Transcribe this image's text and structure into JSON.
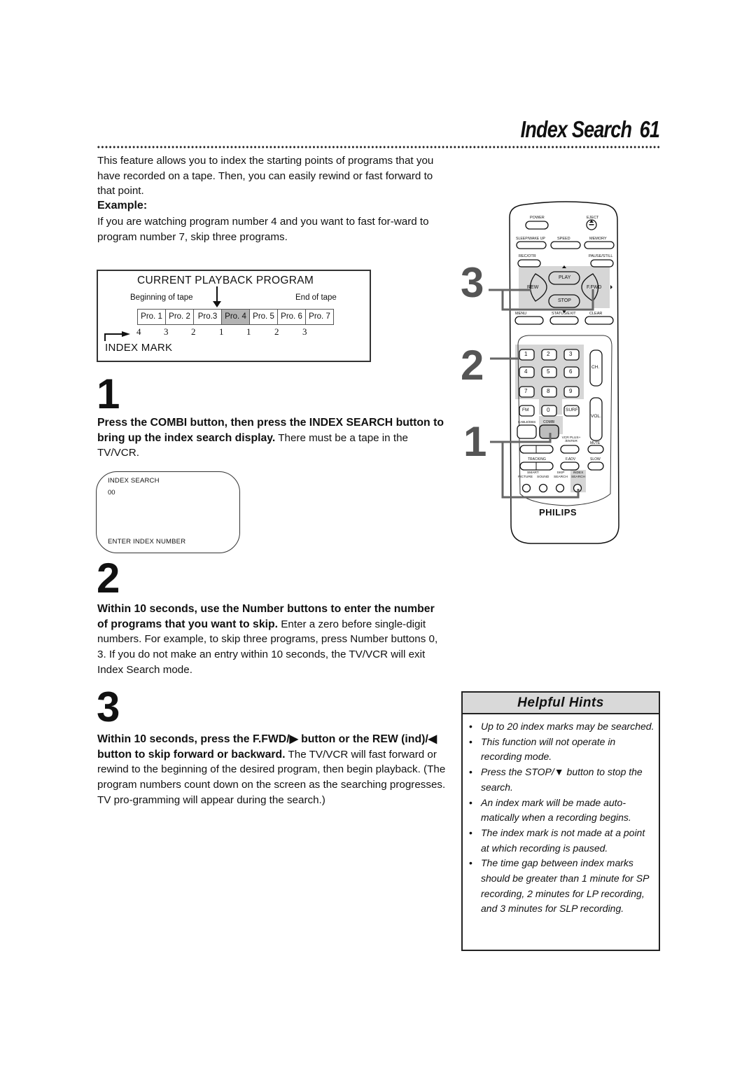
{
  "header": {
    "title": "Index Search",
    "page_number": "61"
  },
  "intro": "This feature allows you to index the starting points of programs that you have recorded on a tape. Then, you can easily rewind or fast forward to that point.",
  "example": {
    "heading": "Example:",
    "text": "If you are watching program number 4 and you want to fast for-ward to program number 7, skip three programs."
  },
  "diagram": {
    "title": "CURRENT PLAYBACK PROGRAM",
    "beginning_label": "Beginning of tape",
    "end_label": "End of tape",
    "programs": [
      "Pro. 1",
      "Pro. 2",
      "Pro.3",
      "Pro. 4",
      "Pro. 5",
      "Pro. 6",
      "Pro. 7"
    ],
    "current_program_index": 3,
    "index_marks": [
      "4",
      "3",
      "2",
      "1",
      "1",
      "2",
      "3"
    ],
    "index_mark_label": "INDEX MARK"
  },
  "steps": [
    {
      "number": "1",
      "bold": "Press the COMBI button, then press the INDEX SEARCH button to bring up the index search display.",
      "text": " There must be a tape in the TV/VCR."
    },
    {
      "number": "2",
      "bold": "Within 10 seconds, use the Number buttons to enter the number of programs that you want to skip.",
      "text": " Enter a zero before single-digit numbers. For example, to skip three programs, press Number buttons 0, 3. If you do not make an entry within 10 seconds, the TV/VCR will exit Index Search mode."
    },
    {
      "number": "3",
      "bold": "Within 10 seconds, press the F.FWD/▶ button or the REW (ind)/◀ button to skip forward or backward.",
      "text": " The TV/VCR will fast forward or rewind to the beginning of the desired program, then begin playback. (The program numbers count down on the screen as the searching progresses. TV pro-gramming will appear during the search.)"
    }
  ],
  "osd_screen": {
    "line1": "INDEX SEARCH",
    "line2": "00",
    "line3": "ENTER INDEX NUMBER"
  },
  "remote": {
    "callouts": [
      "3",
      "2",
      "1"
    ],
    "brand": "PHILIPS",
    "buttons": {
      "power": "POWER",
      "eject": "EJECT",
      "sleep": "SLEEP/WAKE UP",
      "speed": "SPEED",
      "memory": "MEMORY",
      "rec": "REC/OTR",
      "pause": "PAUSE/STILL",
      "play": "PLAY",
      "rew": "REW",
      "ffwd": "F.FWD",
      "stop": "STOP",
      "menu": "MENU",
      "status": "STATUS/EXIT",
      "clear": "CLEAR",
      "digits": [
        "1",
        "2",
        "3",
        "4",
        "5",
        "6",
        "7",
        "8",
        "9"
      ],
      "fm": "FM",
      "zero": "0",
      "surf": "SURF",
      "ch": "CH.",
      "vol": "VOL.",
      "cable": "CABLE/DBS",
      "combi": "COMBI",
      "vcrplus": "VCR PLUS+ /ENTER",
      "mute": "MUTE",
      "tracking": "TRACKING",
      "fadv": "F.ADV",
      "slow": "SLOW",
      "smart": "SMART",
      "picture": "PICTURE",
      "sound": "SOUND",
      "skip": "SKIP SEARCH",
      "index": "INDEX SEARCH"
    }
  },
  "hints": {
    "title": "Helpful Hints",
    "items": [
      "Up to 20 index marks may be searched.",
      "This function will not operate in recording mode.",
      "Press the STOP/▼ button to stop the search.",
      "An index mark will be made auto-matically when a recording begins.",
      "The index mark is not made at a point at which recording is paused.",
      "The time gap between index marks should be greater than 1 minute for SP recording, 2 minutes for LP recording, and 3 minutes for SLP recording."
    ]
  }
}
